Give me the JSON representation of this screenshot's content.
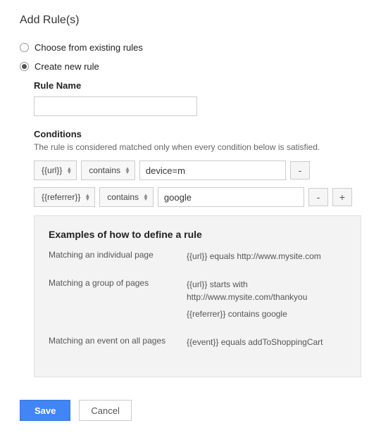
{
  "title": "Add Rule(s)",
  "mode": {
    "existing_label": "Choose from existing rules",
    "create_label": "Create new rule",
    "selected": "create"
  },
  "rule_name": {
    "label": "Rule Name",
    "value": ""
  },
  "conditions": {
    "label": "Conditions",
    "help": "The rule is considered matched only when every condition below is satisfied.",
    "rows": [
      {
        "macro": "{{url}}",
        "op": "contains",
        "value": "device=m",
        "show_remove": true,
        "show_add": false
      },
      {
        "macro": "{{referrer}}",
        "op": "contains",
        "value": "google",
        "show_remove": true,
        "show_add": true
      }
    ],
    "remove_label": "-",
    "add_label": "+"
  },
  "examples": {
    "title": "Examples of how to define a rule",
    "rows": [
      {
        "label": "Matching an individual page",
        "lines": [
          "{{url}} equals http://www.mysite.com"
        ]
      },
      {
        "label": "Matching a group of pages",
        "lines": [
          "{{url}} starts with http://www.mysite.com/thankyou",
          "{{referrer}} contains google"
        ]
      },
      {
        "label": "Matching an event on all pages",
        "lines": [
          "{{event}} equals addToShoppingCart"
        ]
      }
    ]
  },
  "actions": {
    "save": "Save",
    "cancel": "Cancel"
  }
}
